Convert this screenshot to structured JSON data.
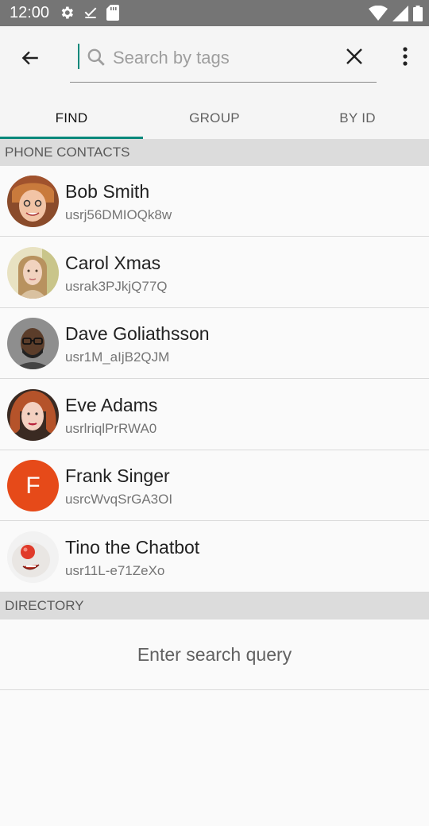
{
  "status_bar": {
    "time": "12:00",
    "left_icons": [
      "gear-icon",
      "download-done-icon",
      "sd-card-icon"
    ],
    "right_icons": [
      "wifi-icon",
      "signal-icon",
      "battery-icon"
    ]
  },
  "toolbar": {
    "back_icon": "arrow-back-icon",
    "search_placeholder": "Search by tags",
    "search_value": "",
    "clear_icon": "close-icon",
    "menu_icon": "more-vert-icon"
  },
  "tabs": [
    {
      "label": "FIND",
      "active": true
    },
    {
      "label": "GROUP",
      "active": false
    },
    {
      "label": "BY ID",
      "active": false
    }
  ],
  "sections": {
    "contacts_header": "PHONE CONTACTS",
    "directory_header": "DIRECTORY"
  },
  "contacts": [
    {
      "name": "Bob Smith",
      "id": "usrj56DMIOQk8w",
      "avatar": "photo"
    },
    {
      "name": "Carol Xmas",
      "id": "usrak3PJkjQ77Q",
      "avatar": "photo"
    },
    {
      "name": "Dave Goliathsson",
      "id": "usr1M_aIjB2QJM",
      "avatar": "photo"
    },
    {
      "name": "Eve Adams",
      "id": "usrlriqlPrRWA0",
      "avatar": "photo"
    },
    {
      "name": "Frank Singer",
      "id": "usrcWvqSrGA3OI",
      "avatar": "letter",
      "letter": "F",
      "color": "#e64a19"
    },
    {
      "name": "Tino the Chatbot",
      "id": "usr11L-e71ZeXo",
      "avatar": "photo"
    }
  ],
  "directory": {
    "empty_text": "Enter search query"
  },
  "colors": {
    "accent": "#00897b",
    "status_bar": "#757575",
    "section_bg": "#dcdcdc"
  }
}
